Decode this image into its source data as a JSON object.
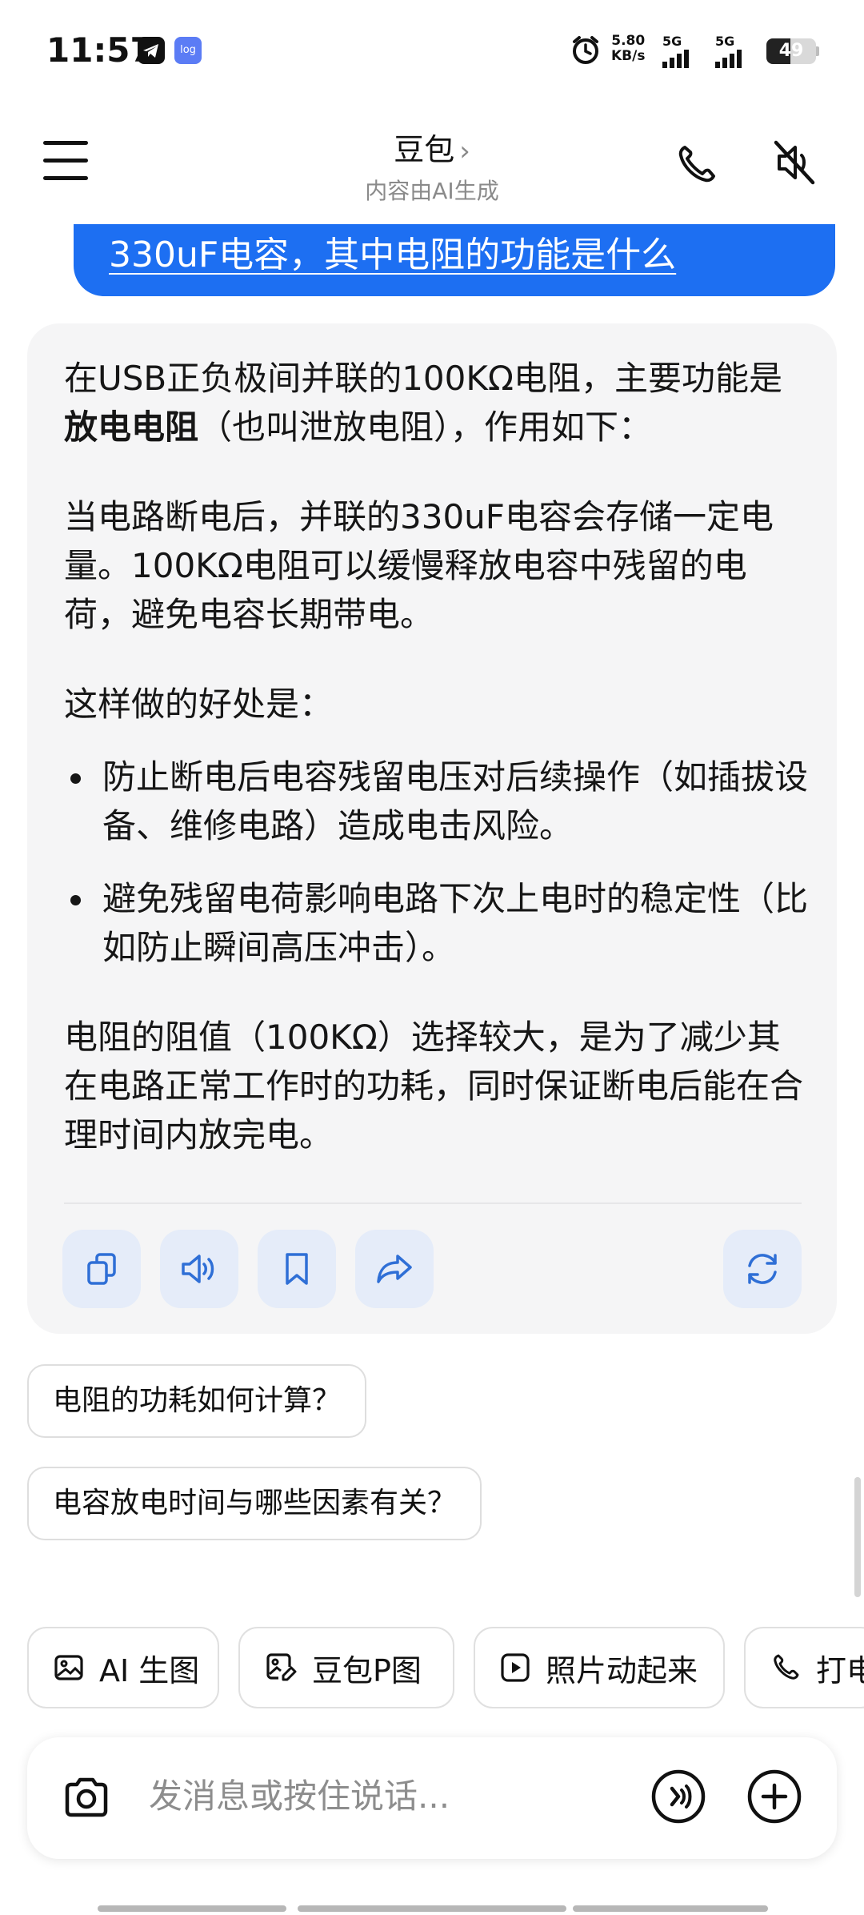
{
  "status_bar": {
    "time": "11:57",
    "log_label": "log",
    "speed_value": "5.80",
    "speed_unit": "KB/s",
    "network1": "5G",
    "network2": "5G",
    "battery": "49",
    "battery_level": 0.49
  },
  "header": {
    "title": "豆包",
    "subtitle": "内容由AI生成"
  },
  "user_message": "330uF电容，其中电阻的功能是什么",
  "ai_reply": {
    "p1_before": "在USB正负极间并联的100KΩ电阻，主要功能是",
    "p1_bold": "放电电阻",
    "p1_after": "（也叫泄放电阻），作用如下：",
    "p2": "当电路断电后，并联的330uF电容会存储一定电量。100KΩ电阻可以缓慢释放电容中残留的电荷，避免电容长期带电。",
    "p3": "这样做的好处是：",
    "bullets": [
      "防止断电后电容残留电压对后续操作（如插拔设备、维修电路）造成电击风险。",
      "避免残留电荷影响电路下次上电时的稳定性（比如防止瞬间高压冲击）。"
    ],
    "p4": "电阻的阻值（100KΩ）选择较大，是为了减少其在电路正常工作时的功耗，同时保证断电后能在合理时间内放完电。"
  },
  "actions": [
    "copy-icon",
    "speaker-icon",
    "bookmark-icon",
    "share-icon",
    "regenerate-icon"
  ],
  "suggestions": [
    "电阻的功耗如何计算？",
    "电容放电时间与哪些因素有关？"
  ],
  "chips": [
    {
      "label": "AI 生图",
      "icon": "image-icon"
    },
    {
      "label": "豆包P图",
      "icon": "photo-edit-icon"
    },
    {
      "label": "照片动起来",
      "icon": "play-icon"
    },
    {
      "label": "打电",
      "icon": "phone-icon"
    }
  ],
  "input": {
    "placeholder": "发消息或按住说话..."
  },
  "colors": {
    "accent": "#1d6ff2",
    "card_bg": "#f5f5f6",
    "action_bg": "#e5ecf9",
    "action_icon": "#2f6fd6"
  }
}
